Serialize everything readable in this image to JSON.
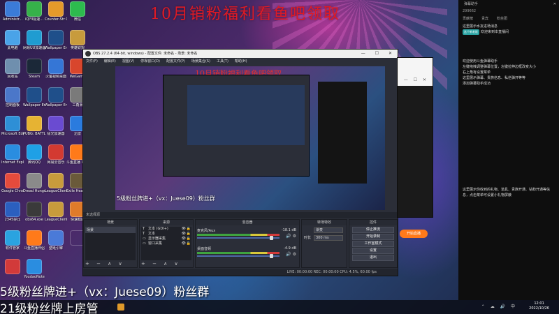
{
  "banner": "10月销粉福利看鱼吧领取",
  "desktop_icons": [
    {
      "label": "Administr...",
      "color": "#3b7bd8"
    },
    {
      "label": "iQIYI极速...",
      "color": "#36b24a"
    },
    {
      "label": "Counter-Str Global Offe...",
      "color": "#e59a2a"
    },
    {
      "label": "微信",
      "color": "#2dbb4e"
    },
    {
      "label": "此电脑",
      "color": "#4aa3e8"
    },
    {
      "label": "网易UU加速器",
      "color": "#1f9cd1"
    },
    {
      "label": "Wallpaper Engine 壁纸引擎",
      "color": "#1f4f8a"
    },
    {
      "label": "英雄联盟",
      "color": "#c89b3c"
    },
    {
      "label": "回收站",
      "color": "#6f8fae"
    },
    {
      "label": "Steam",
      "color": "#1b2838"
    },
    {
      "label": "火萤视频桌面",
      "color": "#3576d6"
    },
    {
      "label": "WeGame",
      "color": "#d8462d"
    },
    {
      "label": "控制面板",
      "color": "#4b77c9"
    },
    {
      "label": "Wallpaper Engine 壁纸引擎",
      "color": "#1f4f8a"
    },
    {
      "label": "Wallpaper Engine",
      "color": "#1f4f8a"
    },
    {
      "label": "三角洲",
      "color": "#7a7a7a"
    },
    {
      "label": "Microsoft Edge",
      "color": "#2e8fd6"
    },
    {
      "label": "PUBG: BATTLEGR...",
      "color": "#e6b333"
    },
    {
      "label": "极光加速器",
      "color": "#6a4bd1"
    },
    {
      "label": "迅雷",
      "color": "#2a7bde"
    },
    {
      "label": "Internet Explorer",
      "color": "#2a8de0"
    },
    {
      "label": "腾讯QQ",
      "color": "#1fa0e6"
    },
    {
      "label": "网易云音乐",
      "color": "#d33a31"
    },
    {
      "label": "斗鱼直播 Demo",
      "color": "#ff7a1a"
    },
    {
      "label": "Google Chrome",
      "color": "#e54b3c"
    },
    {
      "label": "Dread Hunger",
      "color": "#8a8a8a"
    },
    {
      "label": "LeagueClient",
      "color": "#c89b3c"
    },
    {
      "label": "Exile Hearth...",
      "color": "#6a5a3a"
    },
    {
      "label": "2345好压",
      "color": "#2b5fbf"
    },
    {
      "label": "obs64.exe",
      "color": "#3a3a3a"
    },
    {
      "label": "LeagueClient",
      "color": "#c89b3c"
    },
    {
      "label": "快速截图",
      "color": "#e07b2a"
    },
    {
      "label": "软件管家",
      "color": "#2aa3e0"
    },
    {
      "label": "斗鱼直播伴侣",
      "color": "#ff7a1a"
    },
    {
      "label": "壁纸引擎",
      "color": "#4a7ad8"
    },
    {
      "label": "",
      "color": "#00000000"
    },
    {
      "label": "",
      "color": "#d23a3a"
    },
    {
      "label": "YoudaoNote",
      "color": "#2a8de0"
    }
  ],
  "obs": {
    "title": "OBS 27.2.4 (64-bit, windows) - 配置文件: 未命名 - 场景: 未命名",
    "win_controls": "— ☐ ✕",
    "menu": [
      "文件(F)",
      "编辑(E)",
      "视图(V)",
      "停靠窗口(D)",
      "配置文件(P)",
      "场景集合(S)",
      "工具(T)",
      "帮助(H)"
    ],
    "preview_banner": "10月销粉福利看鱼吧领取",
    "preview_caption": "5级粉丝牌进+（vx：Juese09）粉丝群",
    "bar_label": "未选择源",
    "docks": {
      "scenes": {
        "title": "场景",
        "items": [
          "场景"
        ]
      },
      "sources": {
        "title": "来源",
        "items": [
          {
            "label": "文本 (GDI+)",
            "icon": "T"
          },
          {
            "label": "文本",
            "icon": "T"
          },
          {
            "label": "显示器采集",
            "icon": "▭"
          },
          {
            "label": "窗口采集",
            "icon": "▭"
          }
        ]
      },
      "mixer": {
        "title": "混音器",
        "tracks": [
          {
            "name": "麦克风/Aux",
            "db": "-18.1 dB"
          },
          {
            "name": "桌面音频",
            "db": "-4.9 dB"
          }
        ]
      },
      "transitions": {
        "title": "转场特效",
        "type": "渐变",
        "duration_label": "时长",
        "duration": "300 ms"
      },
      "controls": {
        "title": "控件",
        "buttons": [
          "停止推流",
          "开始录制",
          "工作室模式",
          "设置",
          "退出"
        ]
      }
    },
    "footer_controls": "+ − ∧ ∨",
    "status": "LIVE: 00:00:00   REC: 00:00:00   CPU: 4.5%, 60.00 fps"
  },
  "bg_window": {
    "controls": "— ☐ ✕",
    "start_button": "开始直播"
  },
  "chat": {
    "header": "弹幕助手",
    "close": "✕",
    "tabs": [
      "贡献榜",
      "贵宾",
      "粉丝团"
    ],
    "messages": [
      {
        "text": "这里展示水友进场消息",
        "tag": ""
      },
      {
        "text": "欢迎来到本直播间",
        "tag": "这个新老板",
        "tag_color": "#2aa3a3"
      },
      {
        "text": "欢迎使用斗鱼弹幕助手",
        "tag": ""
      },
      {
        "text": "左键拖拽调整弹幕位置，左键拉伸边框改变大小",
        "tag": ""
      },
      {
        "text": "右上角有设置菜单",
        "tag": ""
      },
      {
        "text": "这里展示弹幕、贵族信息、私信弹开等等",
        "tag": ""
      },
      {
        "text": "添加弹幕助手成功",
        "tag": ""
      }
    ],
    "gift_msg": "这里展示你收到的礼物、道具、贵族开通、钻粉开通等信息，点击菜单可设置小礼物屏蔽",
    "viewer_count": "299662"
  },
  "captions": {
    "line1": "5级粉丝牌进+（vx：Juese09）粉丝群",
    "line2": "21级粉丝牌上房管"
  },
  "taskbar": {
    "tray": "⌃ ☁ 🔊 中",
    "time": "12:01",
    "date": "2022/10/26"
  }
}
